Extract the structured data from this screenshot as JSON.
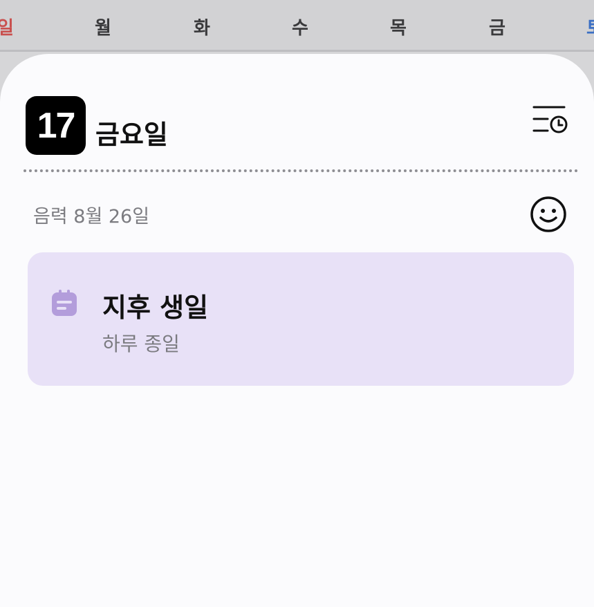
{
  "weekdays": {
    "sun": "일",
    "mon": "월",
    "tue": "화",
    "wed": "수",
    "thu": "목",
    "fri": "금",
    "sat": "토"
  },
  "day_header": {
    "date_number": "17",
    "weekday": "금요일"
  },
  "lunar_date": "음력 8월 26일",
  "event": {
    "title": "지후 생일",
    "subtitle": "하루 종일",
    "icon": "calendar-icon"
  },
  "icons": {
    "schedule": "schedule-list-icon",
    "mood": "smile-icon"
  },
  "colors": {
    "sunday": "#c9504e",
    "saturday": "#3b6fc4",
    "event_background": "#e8e1f7",
    "event_icon": "#b39ddb"
  }
}
